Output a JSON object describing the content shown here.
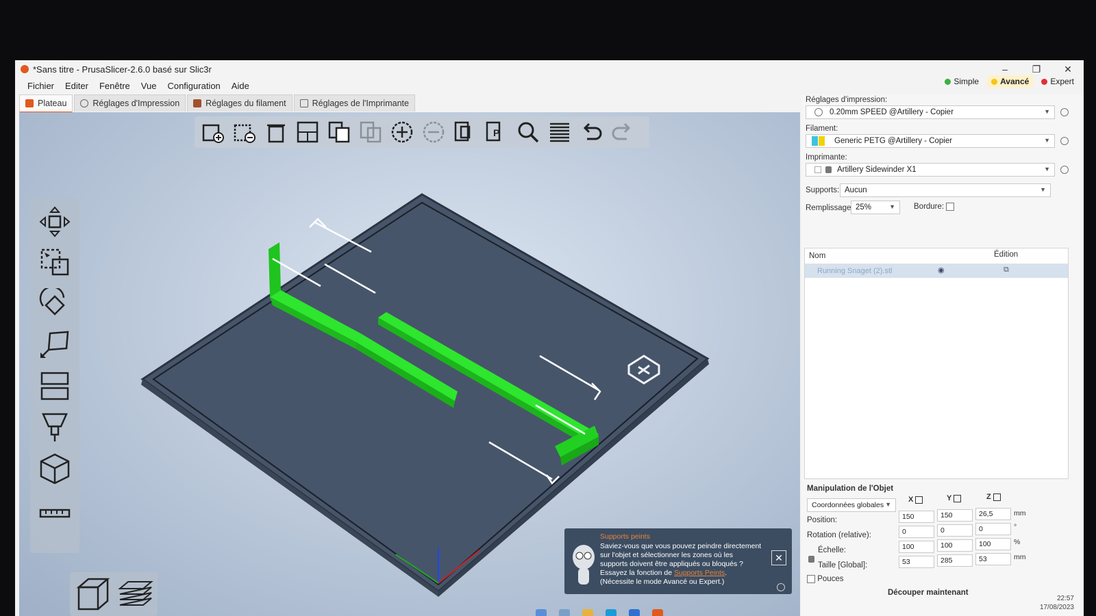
{
  "window": {
    "title": "*Sans titre - PrusaSlicer-2.6.0 basé sur Slic3r",
    "minimize": "–",
    "maximize": "❐",
    "close": "✕"
  },
  "menu": [
    "Fichier",
    "Editer",
    "Fenêtre",
    "Vue",
    "Configuration",
    "Aide"
  ],
  "modes": [
    {
      "label": "Simple",
      "color": "#3cb043",
      "active": false
    },
    {
      "label": "Avancé",
      "color": "#f5c518",
      "active": true
    },
    {
      "label": "Expert",
      "color": "#e0303a",
      "active": false
    }
  ],
  "tabs": [
    {
      "label": "Plateau",
      "icon": "plater-icon",
      "active": true
    },
    {
      "label": "Réglages d'Impression",
      "icon": "print-settings-icon",
      "active": false
    },
    {
      "label": "Réglages du filament",
      "icon": "filament-icon",
      "active": false
    },
    {
      "label": "Réglages de l'Imprimante",
      "icon": "printer-icon",
      "active": false
    }
  ],
  "toolbar_icons": [
    "add-icon",
    "delete-icon",
    "delete-all-icon",
    "arrange-icon",
    "copy-icon",
    "paste-icon",
    "add-instance-icon",
    "remove-instance-icon",
    "split-objects-icon",
    "split-parts-icon",
    "search-icon",
    "layers-editing-icon",
    "undo-icon",
    "redo-icon"
  ],
  "side_tools": [
    "move-icon",
    "select-icon",
    "rotate-icon",
    "scale-icon",
    "cut-icon",
    "place-on-face-icon",
    "paint-supports-icon",
    "measure-box-icon",
    "measure-icon"
  ],
  "notification": {
    "title": "Supports peints",
    "body": "Saviez-vous que vous pouvez peindre directement sur l'objet et sélectionner les zones où les supports doivent être appliqués ou bloqués ? Essayez la fonction de ",
    "link": "Supports Peints",
    "body_end": ". (Nécessite le mode Avancé ou Expert.)"
  },
  "panel": {
    "print_settings_label": "Réglages d'impression:",
    "print_settings_value": "0.20mm SPEED @Artillery - Copier",
    "filament_label": "Filament:",
    "filament_value": "Generic PETG @Artillery - Copier",
    "printer_label": "Imprimante:",
    "printer_value": "Artillery Sidewinder X1",
    "supports_label": "Supports:",
    "supports_value": "Aucun",
    "infill_label": "Remplissage:",
    "infill_value": "25%",
    "brim_label": "Bordure:",
    "list_col_name": "Nom",
    "list_col_edit": "Édition",
    "object_name": "Running Snaget (2).stl",
    "manip_title": "Manipulation de l'Objet",
    "coord_value": "Coordonnées globales",
    "axis_x": "X",
    "axis_y": "Y",
    "axis_z": "Z",
    "position_label": "Position:",
    "position": [
      "150",
      "150",
      "26,5"
    ],
    "position_unit": "mm",
    "rotation_label": "Rotation (relative):",
    "rotation": [
      "0",
      "0",
      "0"
    ],
    "rotation_unit": "°",
    "scale_label": "Échelle:",
    "scale": [
      "100",
      "100",
      "100"
    ],
    "scale_unit": "%",
    "size_label": "Taille [Global]:",
    "size": [
      "53",
      "285",
      "53"
    ],
    "size_unit": "mm",
    "inches_label": "Pouces",
    "slice_button": "Découper maintenant"
  },
  "tray": {
    "time": "22:57",
    "date": "17/08/2023"
  },
  "colors": {
    "accent": "#e05a1e",
    "model": "#2ee62e",
    "bed": "#4a586c",
    "notification": "#3c4d62"
  }
}
